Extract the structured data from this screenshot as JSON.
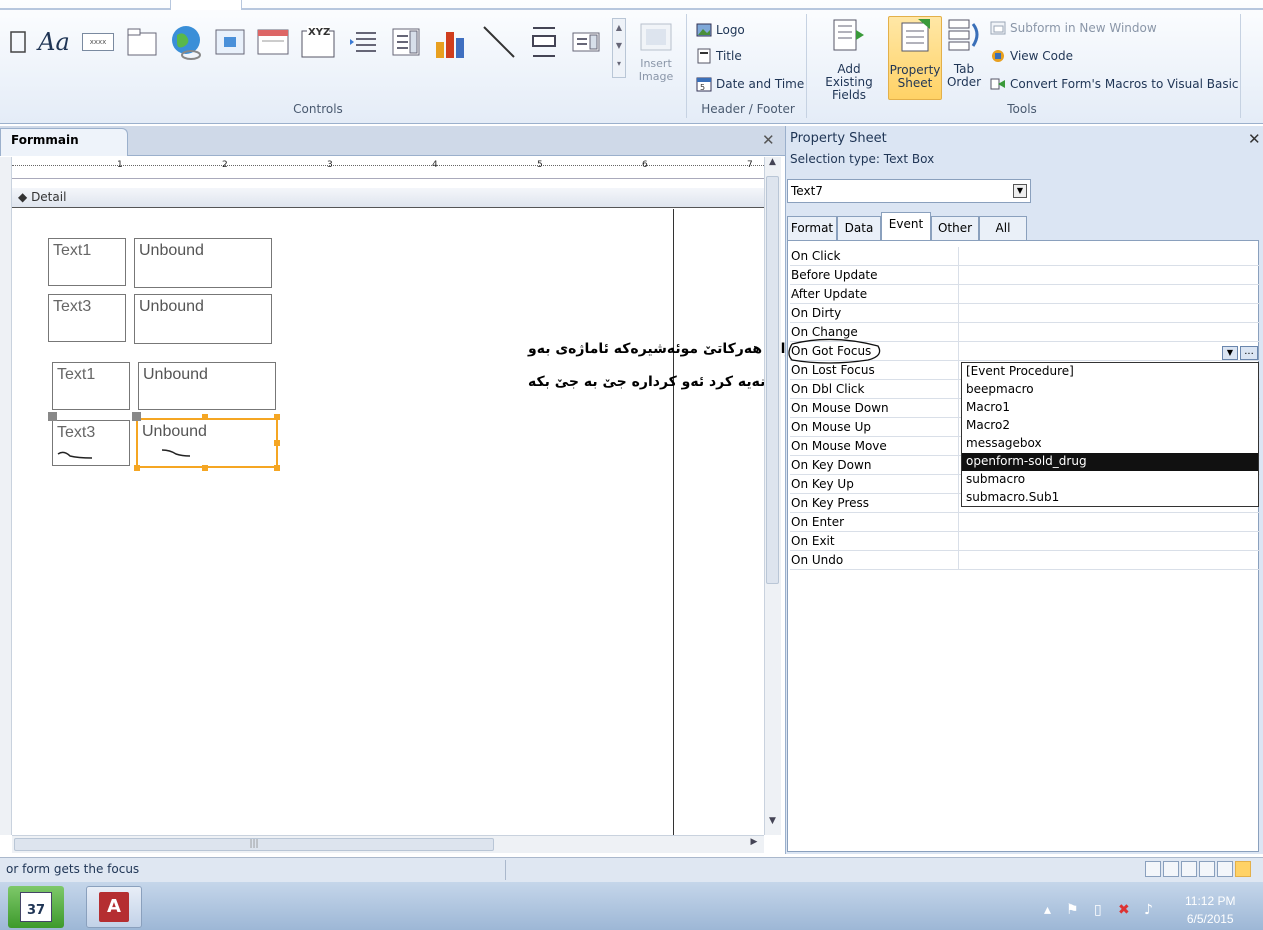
{
  "ribbon": {
    "controls_group_label": "Controls",
    "insert_image_label": "Insert Image",
    "label_control_text": "Aa",
    "textbox_control_text": "xxxx",
    "header_footer": {
      "group_label": "Header / Footer",
      "logo": "Logo",
      "title": "Title",
      "date_and_time": "Date and Time"
    },
    "tools": {
      "group_label": "Tools",
      "add_existing_fields": "Add Existing Fields",
      "property_sheet": "Property Sheet",
      "tab_order": "Tab Order",
      "subform_in_new_window": "Subform in New Window",
      "view_code": "View Code",
      "convert_macros": "Convert Form's Macros to Visual Basic"
    }
  },
  "document": {
    "tab_title": "Formmain",
    "section_label": "Detail",
    "ruler_numbers": [
      "1",
      "2",
      "3",
      "4",
      "5",
      "6",
      "7"
    ],
    "controls": [
      {
        "label": "Text1",
        "text": "Unbound"
      },
      {
        "label": "Text3",
        "text": "Unbound"
      },
      {
        "label": "Text1",
        "text": "Unbound"
      },
      {
        "label": "Text3",
        "text": "Unbound"
      }
    ],
    "annotation_line1": "واتە هەرکاتێ موئەشیرەکە ئاماژەی بەو",
    "annotation_line2": "خانەیە کرد ئەو کردارە جێ بە جێ بکە"
  },
  "property_sheet": {
    "title": "Property Sheet",
    "selection_type": "Selection type:  Text Box",
    "selected_object": "Text7",
    "tabs": [
      "Format",
      "Data",
      "Event",
      "Other",
      "All"
    ],
    "active_tab": "Event",
    "events": [
      "On Click",
      "Before Update",
      "After Update",
      "On Dirty",
      "On Change",
      "On Got Focus",
      "On Lost Focus",
      "On Dbl Click",
      "On Mouse Down",
      "On Mouse Up",
      "On Mouse Move",
      "On Key Down",
      "On Key Up",
      "On Key Press",
      "On Enter",
      "On Exit",
      "On Undo"
    ],
    "dropdown_options": [
      "[Event Procedure]",
      "beepmacro",
      "Macro1",
      "Macro2",
      "messagebox",
      "openform-sold_drug",
      "submacro",
      "submacro.Sub1"
    ],
    "selected_option": "openform-sold_drug"
  },
  "status_bar": {
    "text": "or form gets the focus"
  },
  "taskbar": {
    "time": "11:12 PM",
    "date": "6/5/2015",
    "calendar_day": "37"
  },
  "colors": {
    "accent_orange": "#f5a623",
    "selected_row_bg": "#111111",
    "ribbon_bg": "#e4ecf7"
  }
}
